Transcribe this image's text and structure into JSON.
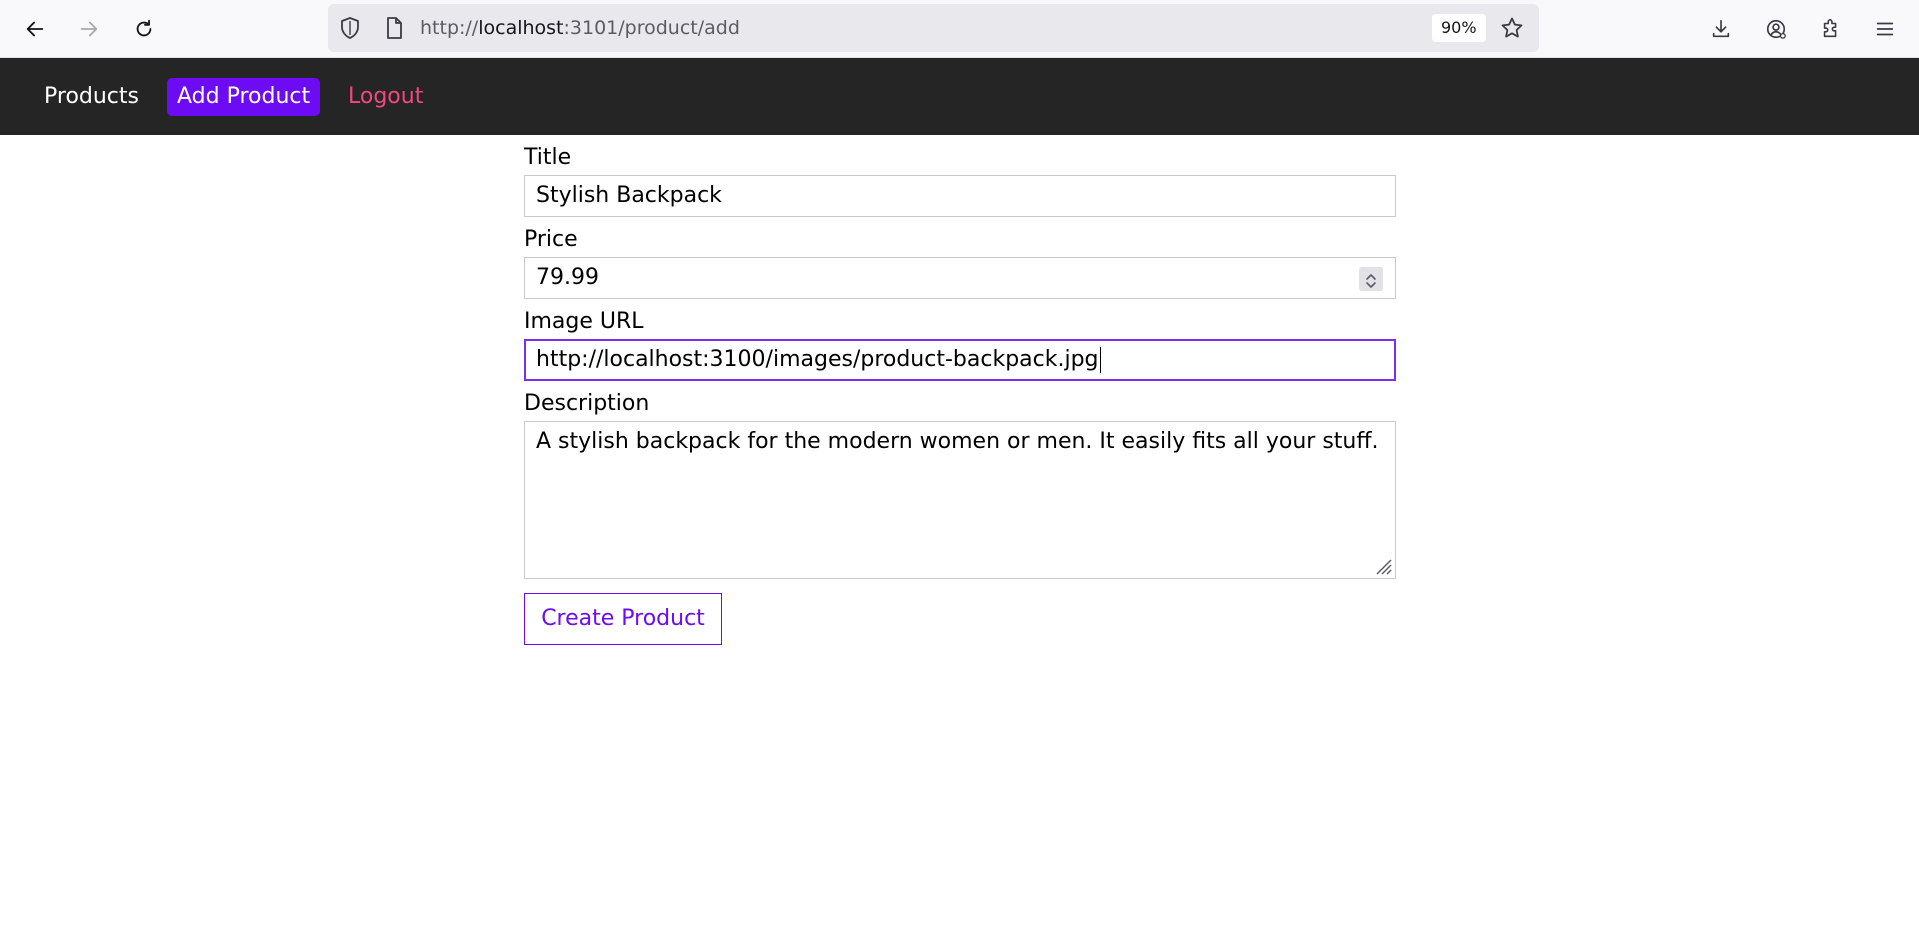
{
  "browser": {
    "url_prefix": "http://",
    "url_host": "localhost",
    "url_path": ":3101/product/add",
    "zoom": "90%",
    "icons": [
      "back-arrow-icon",
      "forward-arrow-icon",
      "reload-icon",
      "shield-icon",
      "page-icon",
      "star-icon",
      "download-icon",
      "account-icon",
      "extensions-icon",
      "menu-icon"
    ]
  },
  "nav": {
    "products_label": "Products",
    "add_product_label": "Add Product",
    "logout_label": "Logout",
    "active": "Add Product",
    "colors": {
      "bar": "#252525",
      "active_bg": "#6d0bf5",
      "logout": "#f2487e"
    }
  },
  "form": {
    "title_label": "Title",
    "title_value": "Stylish Backpack",
    "price_label": "Price",
    "price_value": "79.99",
    "image_label": "Image URL",
    "image_value": "http://localhost:3100/images/product-backpack.jpg",
    "description_label": "Description",
    "description_value": "A stylish backpack for the modern women or men. It easily fits all your stuff.",
    "submit_label": "Create Product",
    "focused_field": "Image URL",
    "accent_color": "#6d0bf5"
  }
}
